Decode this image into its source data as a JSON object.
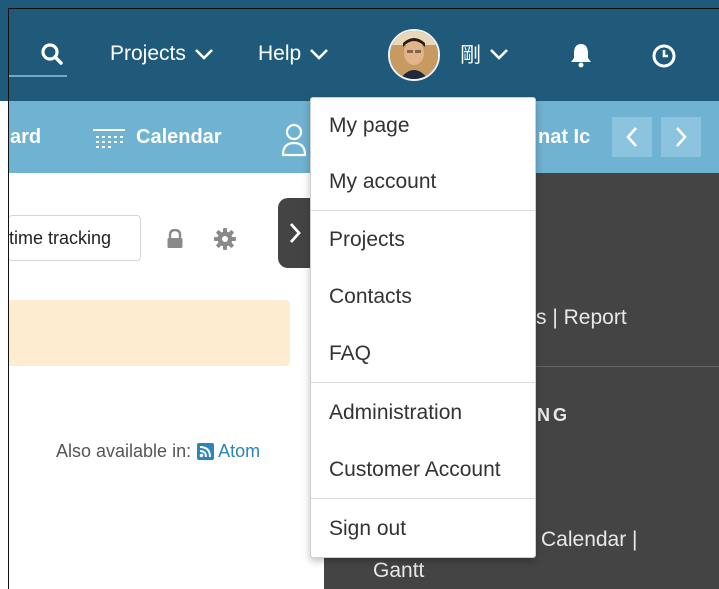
{
  "colors": {
    "topbar": "#1f5a7a",
    "subbar": "#6fb2d1",
    "dark_panel": "#444444",
    "flash_bg": "#fdeccf",
    "link": "#2a85b8"
  },
  "topbar": {
    "search_icon": "search-icon",
    "projects_label": "Projects",
    "help_label": "Help",
    "user_label": "剛",
    "bell_icon": "bell-icon",
    "clock_icon": "clock-icon"
  },
  "subbar": {
    "dashboard_fragment": "ard",
    "calendar_label": "Calendar",
    "chat_fragment": "nat Ic"
  },
  "content": {
    "time_tracking_label": "time tracking",
    "also_available": "Also available in:",
    "atom_label": "Atom"
  },
  "dark_panel": {
    "report_text": "s | Report",
    "heading_fragment": "NG",
    "calendar_text": "Calendar |",
    "gantt_text": "Gantt"
  },
  "user_menu": {
    "items": [
      {
        "label": "My page"
      },
      {
        "label": "My account"
      },
      {
        "label": "Projects"
      },
      {
        "label": "Contacts"
      },
      {
        "label": "FAQ"
      },
      {
        "label": "Administration"
      },
      {
        "label": "Customer Account"
      },
      {
        "label": "Sign out"
      }
    ]
  }
}
